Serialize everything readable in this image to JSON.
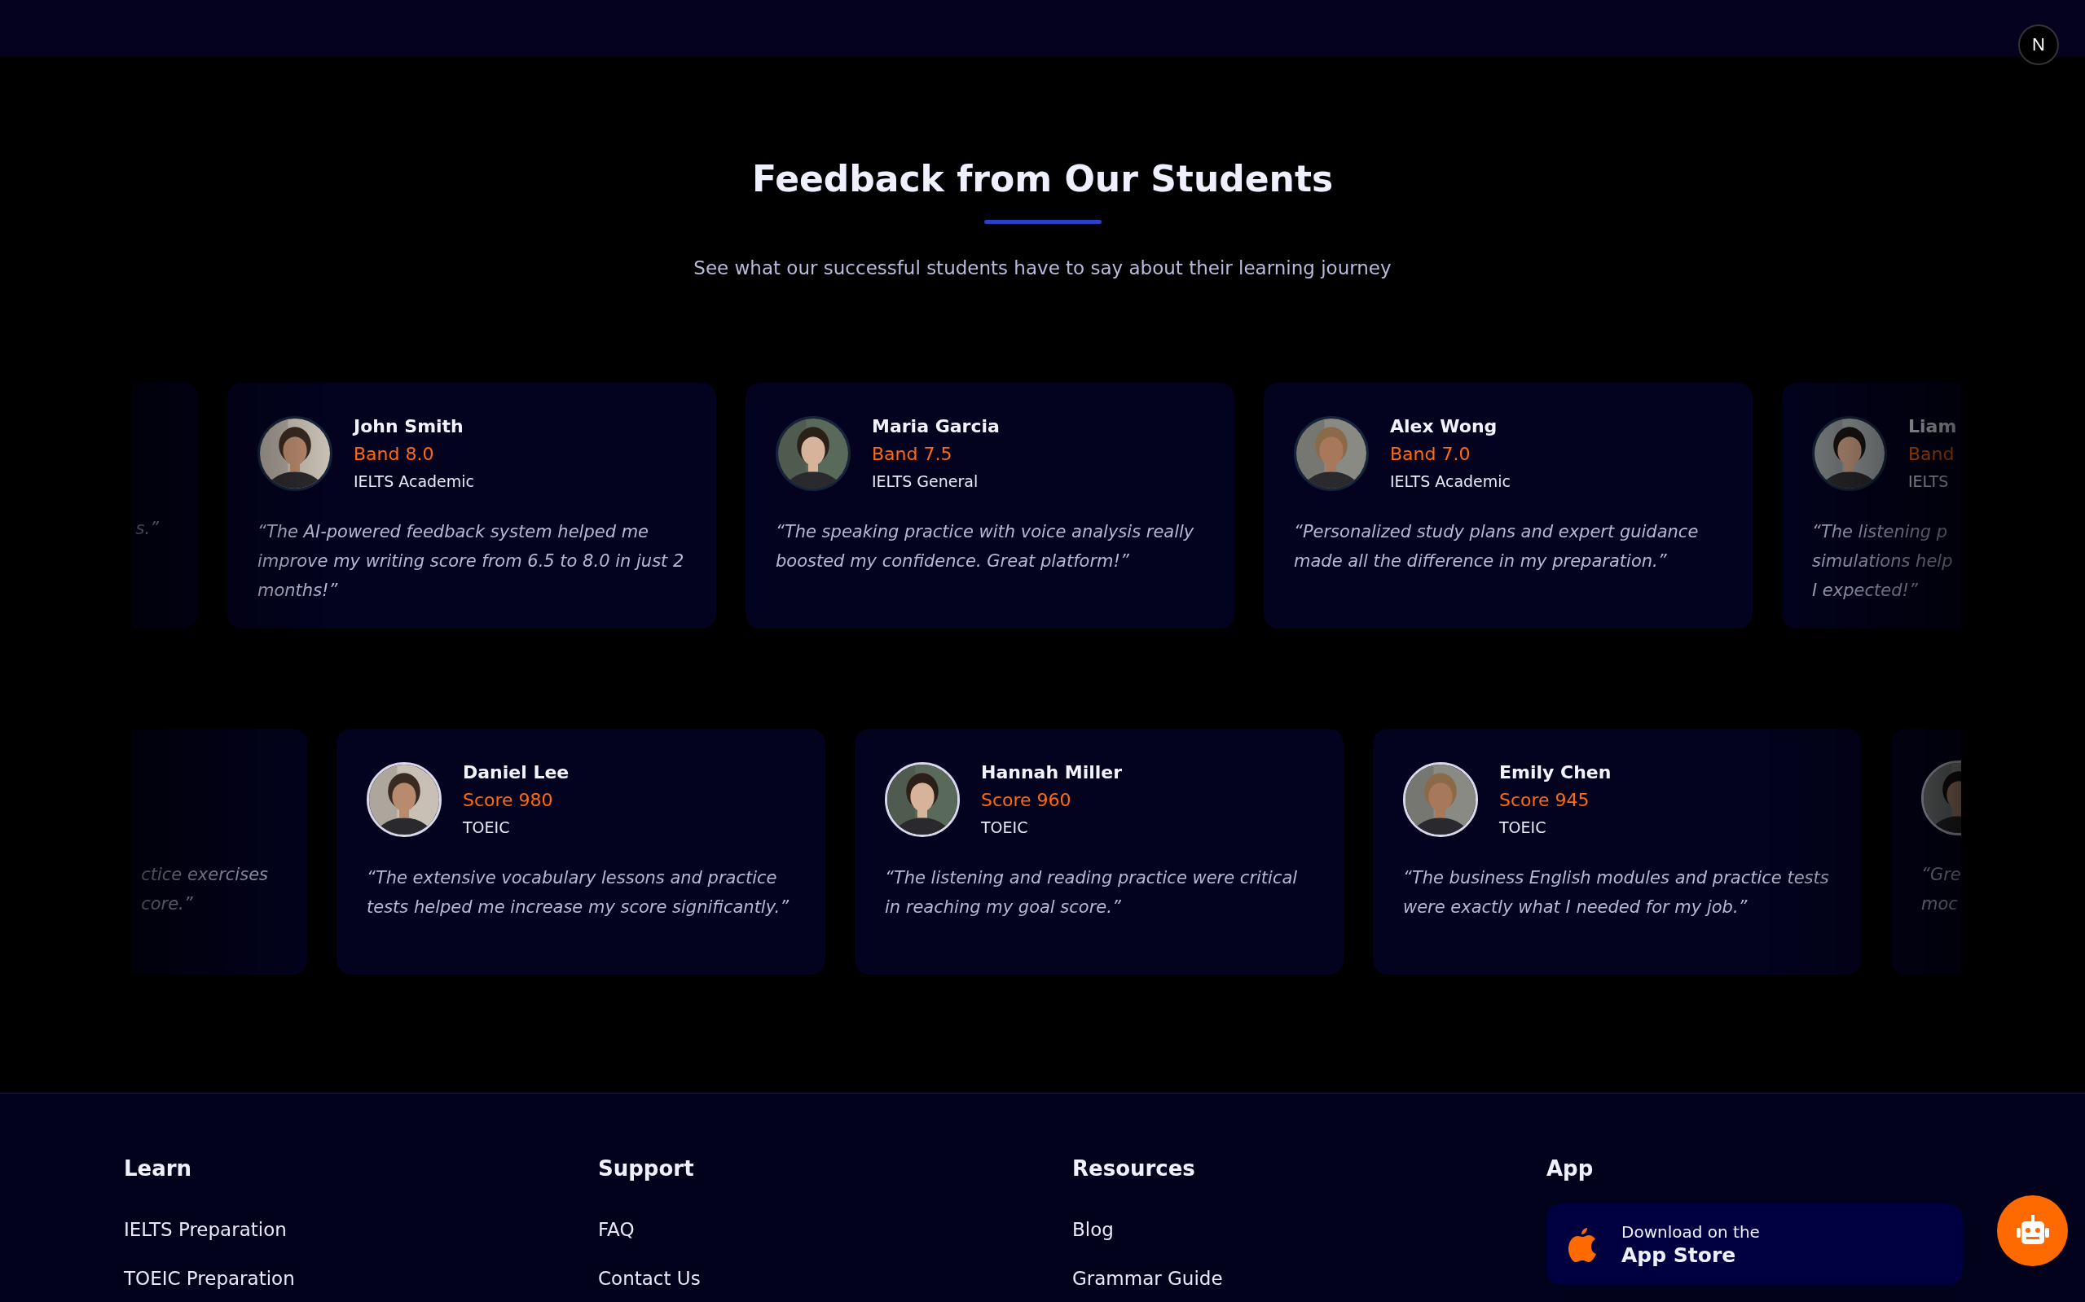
{
  "dev_badge": {
    "text": "N"
  },
  "section": {
    "title": "Feedback from Our Students",
    "subtitle": "See what our successful students have to say about their learning journey"
  },
  "rows": [
    {
      "cards": [
        {
          "kind": "partial",
          "quote_lines": [
            "s.”"
          ]
        },
        {
          "kind": "full",
          "avatar": {
            "kind": "picture"
          },
          "name": "John Smith",
          "score": "Band 8.0",
          "exam": "IELTS Academic",
          "quote": "“The AI-powered feedback system helped me improve my writing score from 6.5 to 8.0 in just 2 months!”"
        },
        {
          "kind": "full",
          "avatar": {
            "kind": "picture"
          },
          "name": "Maria Garcia",
          "score": "Band 7.5",
          "exam": "IELTS General",
          "quote": "“The speaking practice with voice analysis really boosted my confidence. Great platform!”"
        },
        {
          "kind": "full",
          "avatar": {
            "kind": "picture"
          },
          "name": "Alex Wong",
          "score": "Band 7.0",
          "exam": "IELTS Academic",
          "quote": "“Personalized study plans and expert guidance made all the difference in my preparation.”"
        },
        {
          "kind": "partial",
          "avatar": {
            "kind": "picture"
          },
          "name": "Liam",
          "score": "Band",
          "exam": "IELTS",
          "quote_lines": [
            "“The listening p",
            "simulations help",
            "I expected!”"
          ]
        }
      ]
    },
    {
      "cards": [
        {
          "kind": "partial",
          "quote_lines": [
            "ctice exercises",
            "core.”"
          ]
        },
        {
          "kind": "full",
          "avatar": {
            "kind": "picture"
          },
          "name": "Daniel Lee",
          "score": "Score 980",
          "exam": "TOEIC",
          "quote": "“The extensive vocabulary lessons and practice tests helped me increase my score significantly.”"
        },
        {
          "kind": "full",
          "avatar": {
            "kind": "picture"
          },
          "name": "Hannah Miller",
          "score": "Score 960",
          "exam": "TOEIC",
          "quote": "“The listening and reading practice were critical in reaching my goal score.”"
        },
        {
          "kind": "full",
          "avatar": {
            "kind": "picture"
          },
          "name": "Emily Chen",
          "score": "Score 945",
          "exam": "TOEIC",
          "quote": "“The business English modules and practice tests were exactly what I needed for my job.”"
        },
        {
          "kind": "partial",
          "avatar": {
            "kind": "picture"
          },
          "quote_lines": [
            "“Gre",
            "moc"
          ]
        }
      ]
    }
  ],
  "footer": {
    "columns": [
      {
        "heading": "Learn",
        "links": [
          "IELTS Preparation",
          "TOEIC Preparation"
        ]
      },
      {
        "heading": "Support",
        "links": [
          "FAQ",
          "Contact Us"
        ]
      },
      {
        "heading": "Resources",
        "links": [
          "Blog",
          "Grammar Guide"
        ]
      },
      {
        "heading": "App",
        "app_button": {
          "small": "Download on the",
          "large": "App Store"
        }
      }
    ]
  }
}
